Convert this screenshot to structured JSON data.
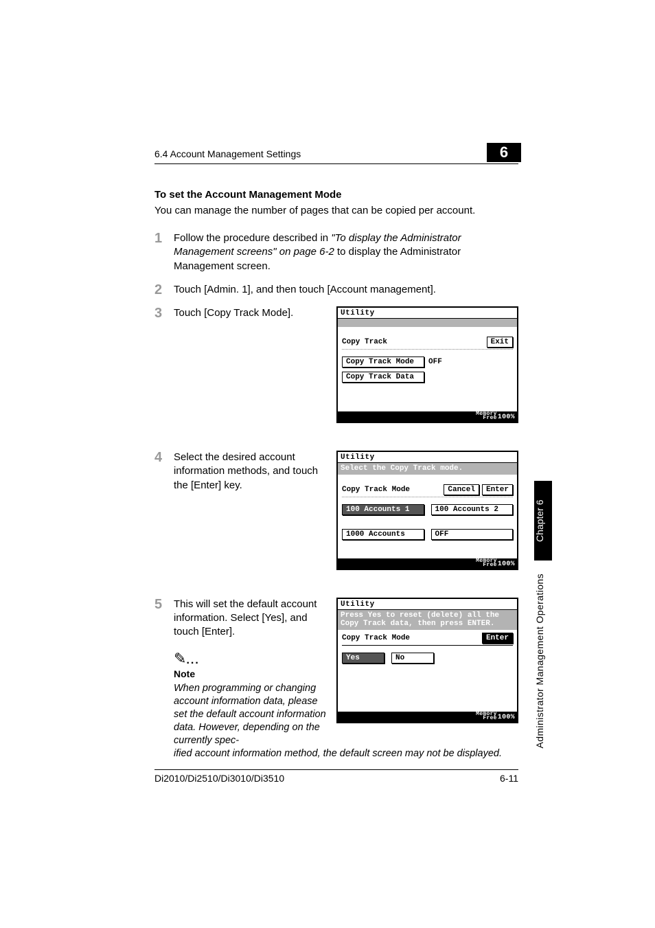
{
  "header": {
    "section": "6.4 Account Management Settings",
    "chapter_num": "6"
  },
  "section_title": "To set the Account Management Mode",
  "intro": "You can manage the number of pages that can be copied per account.",
  "steps": {
    "s1": {
      "num": "1",
      "pre": "Follow the procedure described in ",
      "ital": "\"To display the Administrator Management screens\" on page 6-2",
      "post": " to display the Administrator Management screen."
    },
    "s2": {
      "num": "2",
      "text": "Touch [Admin. 1], and then touch [Account management]."
    },
    "s3": {
      "num": "3",
      "text": "Touch [Copy Track Mode]."
    },
    "s4": {
      "num": "4",
      "text": "Select the desired account information methods, and touch the [Enter] key."
    },
    "s5": {
      "num": "5",
      "text": "This will set the default account information. Select [Yes], and touch [Enter]."
    }
  },
  "note": {
    "title": "Note",
    "body1": "When programming or changing account information data, please set the default account information data. However, depending on the currently spec-",
    "body2": "ified account information method, the default screen may not be displayed."
  },
  "screen1": {
    "utility": "Utility",
    "title": "Copy Track",
    "exit": "Exit",
    "btn_mode": "Copy Track Mode",
    "mode_state": "OFF",
    "btn_data": "Copy Track Data",
    "mem_label": "Memory\nFree",
    "mem_val": "100%"
  },
  "screen2": {
    "utility": "Utility",
    "instruction": "Select the Copy Track mode.",
    "title": "Copy Track Mode",
    "cancel": "Cancel",
    "enter": "Enter",
    "opt1": "100 Accounts 1",
    "opt2": "100 Accounts 2",
    "opt3": "1000 Accounts",
    "opt4": "OFF",
    "mem_label": "Memory\nFree",
    "mem_val": "100%"
  },
  "screen3": {
    "utility": "Utility",
    "instruction": "Press Yes to reset (delete) all the Copy Track data, then press ENTER.",
    "title": "Copy Track Mode",
    "enter": "Enter",
    "yes": "Yes",
    "no": "No",
    "mem_label": "Memory\nFree",
    "mem_val": "100%"
  },
  "footer": {
    "model": "Di2010/Di2510/Di3010/Di3510",
    "page": "6-11"
  },
  "side": {
    "chapter": "Chapter 6",
    "title": "Administrator Management Operations"
  }
}
